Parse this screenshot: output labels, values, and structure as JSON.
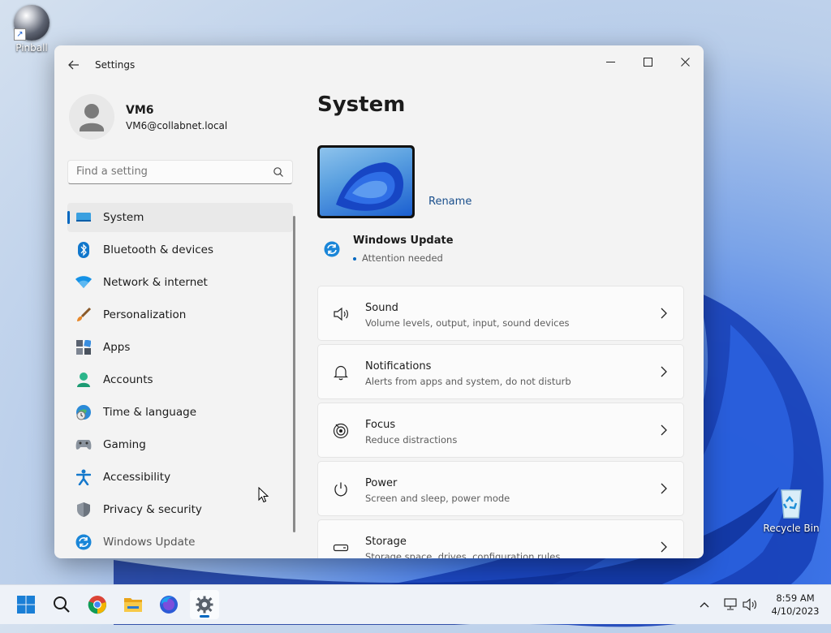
{
  "desktop": {
    "icons": [
      {
        "label": "Pinball"
      },
      {
        "label": "Recycle Bin"
      }
    ]
  },
  "window": {
    "title": "Settings",
    "controls": {
      "minimize": "minimize-icon",
      "maximize": "maximize-icon",
      "close": "close-icon"
    }
  },
  "profile": {
    "name": "VM6",
    "email": "VM6@collabnet.local"
  },
  "search": {
    "placeholder": "Find a setting"
  },
  "nav": {
    "items": [
      {
        "label": "System",
        "icon": "system-icon",
        "active": true
      },
      {
        "label": "Bluetooth & devices",
        "icon": "bluetooth-icon"
      },
      {
        "label": "Network & internet",
        "icon": "wifi-icon"
      },
      {
        "label": "Personalization",
        "icon": "brush-icon"
      },
      {
        "label": "Apps",
        "icon": "apps-icon"
      },
      {
        "label": "Accounts",
        "icon": "accounts-icon"
      },
      {
        "label": "Time & language",
        "icon": "globe-clock-icon"
      },
      {
        "label": "Gaming",
        "icon": "gamepad-icon"
      },
      {
        "label": "Accessibility",
        "icon": "accessibility-icon"
      },
      {
        "label": "Privacy & security",
        "icon": "shield-icon"
      },
      {
        "label": "Windows Update",
        "icon": "windows-update-icon"
      }
    ]
  },
  "main": {
    "title": "System",
    "rename_label": "Rename",
    "windows_update": {
      "title": "Windows Update",
      "status": "Attention needed"
    },
    "cards": [
      {
        "title": "Sound",
        "subtitle": "Volume levels, output, input, sound devices",
        "icon": "speaker-icon"
      },
      {
        "title": "Notifications",
        "subtitle": "Alerts from apps and system, do not disturb",
        "icon": "bell-icon"
      },
      {
        "title": "Focus",
        "subtitle": "Reduce distractions",
        "icon": "focus-icon"
      },
      {
        "title": "Power",
        "subtitle": "Screen and sleep, power mode",
        "icon": "power-icon"
      },
      {
        "title": "Storage",
        "subtitle": "Storage space, drives, configuration rules",
        "icon": "storage-icon"
      }
    ]
  },
  "taskbar": {
    "apps": [
      "start-icon",
      "search-icon",
      "chrome-icon",
      "file-explorer-icon",
      "firefox-icon",
      "settings-icon"
    ],
    "clock": {
      "time": "8:59 AM",
      "date": "4/10/2023"
    }
  },
  "colors": {
    "accent": "#0067c0",
    "window_bg": "#f3f3f3",
    "card_bg": "#fbfbfb"
  }
}
